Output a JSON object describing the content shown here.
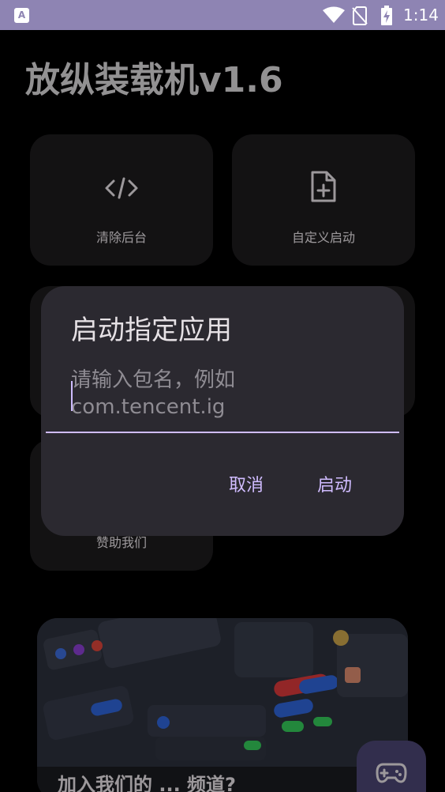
{
  "status_bar": {
    "time": "1:14",
    "app_notification_letter": "A"
  },
  "app": {
    "title": "放纵装载机v1.6"
  },
  "tiles": [
    {
      "label": "清除后台",
      "icon": "code-icon"
    },
    {
      "label": "自定义启动",
      "icon": "file-plus-icon"
    },
    {
      "label": "",
      "icon": ""
    },
    {
      "label": "",
      "icon": ""
    },
    {
      "label": "赞助我们",
      "icon": ""
    }
  ],
  "banner": {
    "text": "加入我们的 ... 频道?"
  },
  "dialog": {
    "title": "启动指定应用",
    "input_placeholder": "请输入包名，例如com.tencent.ig",
    "input_value": "",
    "cancel_label": "取消",
    "confirm_label": "启动"
  },
  "colors": {
    "status_bar": "#8e84b3",
    "surface": "#1c1b1d",
    "dialog": "#2b2930",
    "accent": "#d0bcff"
  }
}
